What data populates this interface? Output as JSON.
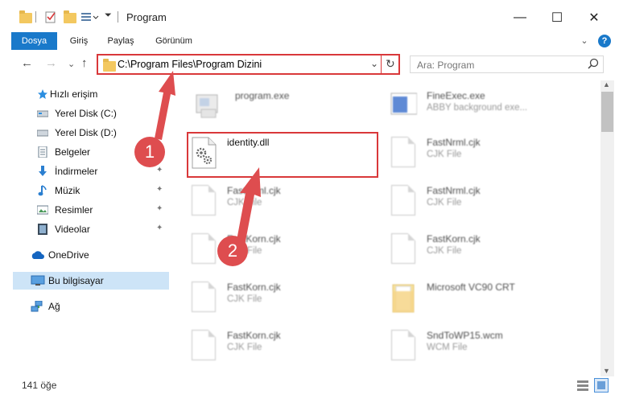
{
  "window": {
    "title": "Program",
    "minimize_glyph": "—",
    "maximize_glyph": "☐",
    "close_glyph": "✕"
  },
  "ribbon": {
    "tabs": [
      "Dosya",
      "Giriş",
      "Paylaş",
      "Görünüm"
    ],
    "collapse_glyph": "⌄",
    "help_glyph": "?"
  },
  "address": {
    "path": "C:\\Program Files\\Program Dizini",
    "dropdown_glyph": "⌄",
    "refresh_glyph": "↻"
  },
  "search": {
    "placeholder": "Ara: Program",
    "icon": "magnifier-icon"
  },
  "nav": {
    "back": "←",
    "forward": "→",
    "recent": "⌄",
    "up": "↑"
  },
  "sidebar": {
    "items": [
      {
        "label": "Hızlı erişim",
        "icon": "star-icon",
        "pinned": false
      },
      {
        "label": "Yerel Disk (C:)",
        "icon": "drive-icon",
        "pinned": false
      },
      {
        "label": "Yerel Disk (D:)",
        "icon": "drive-icon",
        "pinned": false
      },
      {
        "label": "Belgeler",
        "icon": "documents-icon",
        "pinned": true
      },
      {
        "label": "İndirmeler",
        "icon": "download-icon",
        "pinned": true
      },
      {
        "label": "Müzik",
        "icon": "music-icon",
        "pinned": true
      },
      {
        "label": "Resimler",
        "icon": "pictures-icon",
        "pinned": true
      },
      {
        "label": "Videolar",
        "icon": "videos-icon",
        "pinned": true
      },
      {
        "label": "OneDrive",
        "icon": "cloud-icon",
        "pinned": false
      },
      {
        "label": "Bu bilgisayar",
        "icon": "computer-icon",
        "pinned": false
      },
      {
        "label": "Ağ",
        "icon": "network-icon",
        "pinned": false
      }
    ],
    "pin_glyph": "📌"
  },
  "files": [
    {
      "name": "program.exe",
      "type": "",
      "icon": "exe-icon"
    },
    {
      "name": "FineExec.exe",
      "type": "ABBY background exe...",
      "icon": "app-icon"
    },
    {
      "name": "identity.dll",
      "type": "",
      "icon": "dll-gears-icon"
    },
    {
      "name": "FastNrml.cjk",
      "type": "CJK File",
      "icon": "file-icon"
    },
    {
      "name": "FastNrml.cjk",
      "type": "CJK File",
      "icon": "file-icon"
    },
    {
      "name": "FastNrml.cjk",
      "type": "CJK File",
      "icon": "file-icon"
    },
    {
      "name": "FastKorn.cjk",
      "type": "CJK File",
      "icon": "file-icon"
    },
    {
      "name": "FastKorn.cjk",
      "type": "CJK File",
      "icon": "file-icon"
    },
    {
      "name": "FastKorn.cjk",
      "type": "CJK File",
      "icon": "file-icon"
    },
    {
      "name": "Microsoft VC90 CRT",
      "type": "",
      "icon": "folder-icon"
    },
    {
      "name": "FastKorn.cjk",
      "type": "CJK File",
      "icon": "file-icon"
    },
    {
      "name": "SndToWP15.wcm",
      "type": "WCM File",
      "icon": "file-icon"
    }
  ],
  "status": {
    "count": "141 öğe"
  },
  "annotations": {
    "step1": "1",
    "step2": "2"
  },
  "colors": {
    "accent": "#1979ca",
    "highlight": "#d9383a",
    "selection": "#cde4f7"
  }
}
